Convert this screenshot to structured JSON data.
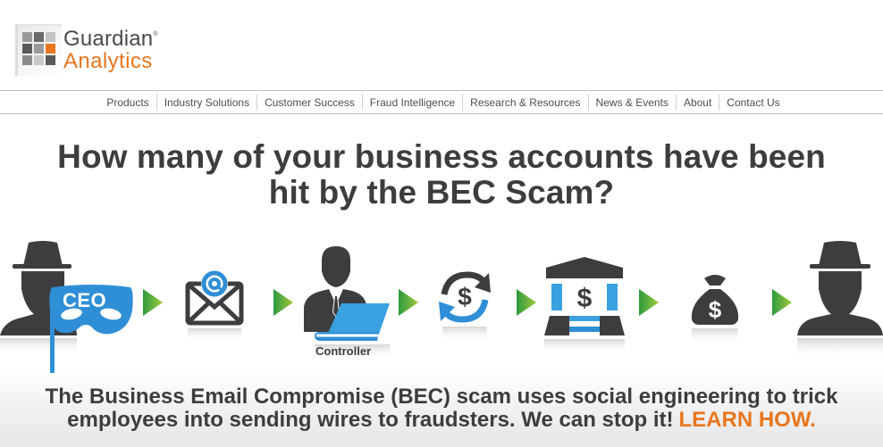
{
  "brand": {
    "name_line1": "Guardian",
    "registered_mark": "®",
    "name_line2": "Analytics",
    "colors": {
      "orange": "#e8761e",
      "dark_gray": "#3d3d40",
      "blue": "#2f8fd6",
      "green": "#3aa83c"
    }
  },
  "nav": {
    "items": [
      {
        "label": "Products"
      },
      {
        "label": "Industry Solutions"
      },
      {
        "label": "Customer Success"
      },
      {
        "label": "Fraud Intelligence"
      },
      {
        "label": "Research & Resources"
      },
      {
        "label": "News & Events"
      },
      {
        "label": "About"
      },
      {
        "label": "Contact Us"
      }
    ]
  },
  "hero": {
    "headline_line1": "How many of your business accounts have been",
    "headline_line2": "hit by the BEC Scam?",
    "flow": [
      {
        "icon": "fraudster-with-ceo-mask-icon",
        "label": "CEO"
      },
      {
        "icon": "email-at-icon"
      },
      {
        "icon": "controller-with-laptop-icon",
        "label": "Controller"
      },
      {
        "icon": "money-transfer-cycle-icon"
      },
      {
        "icon": "bank-icon"
      },
      {
        "icon": "money-bag-icon"
      },
      {
        "icon": "fraudster-icon"
      }
    ],
    "arrow_icon": "green-arrow-right-icon"
  },
  "banner": {
    "text_line1": "The Business Email Compromise (BEC) scam uses social engineering to trick",
    "text_line2": "employees into sending wires to fraudsters. We can stop it!",
    "cta": "LEARN HOW."
  }
}
